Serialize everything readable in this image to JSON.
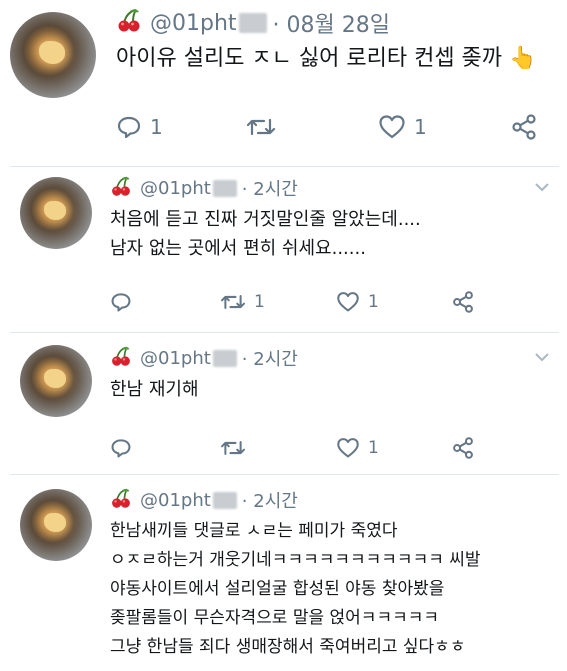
{
  "tweets": [
    {
      "handle": "@01pht",
      "time": "· 08월 28일",
      "lines": [
        "아이유 설리도 ㅈㄴ 싫어 로리타 컨셉 좆까"
      ],
      "emoji": "👆",
      "reply_count": "1",
      "retweet_count": "",
      "like_count": "1"
    },
    {
      "handle": "@01pht",
      "time": "· 2시간",
      "lines": [
        "처음에 듣고 진짜 거짓말인줄 알았는데....",
        "남자 없는 곳에서 편히 쉬세요......"
      ],
      "reply_count": "",
      "retweet_count": "1",
      "like_count": "1"
    },
    {
      "handle": "@01pht",
      "time": "· 2시간",
      "lines": [
        "한남 재기해"
      ],
      "reply_count": "",
      "retweet_count": "",
      "like_count": "1"
    },
    {
      "handle": "@01pht",
      "time": "· 2시간",
      "lines": [
        "한남새끼들 댓글로 ㅅㄹ는 페미가 죽였다",
        "ㅇㅈㄹ하는거 개웃기네ㅋㅋㅋㅋㅋㅋㅋㅋㅋㅋㅋ 씨발",
        "야동사이트에서 설리얼굴 합성된 야동 찾아봤을",
        "좆팔롬들이 무슨자격으로 말을 얹어ㅋㅋㅋㅋㅋ",
        "그냥 한남들 죄다 생매장해서 죽여버리고 싶다ㅎㅎ"
      ]
    }
  ],
  "icons": {
    "profile_emoji": "cherry-icon",
    "reply": "reply-icon",
    "retweet": "retweet-icon",
    "like": "heart-icon",
    "share": "share-icon",
    "more": "chevron-down-icon"
  },
  "colors": {
    "text": "#14171a",
    "secondary": "#657786",
    "divider": "#e1e8ed",
    "cherry": "#d9212e"
  }
}
